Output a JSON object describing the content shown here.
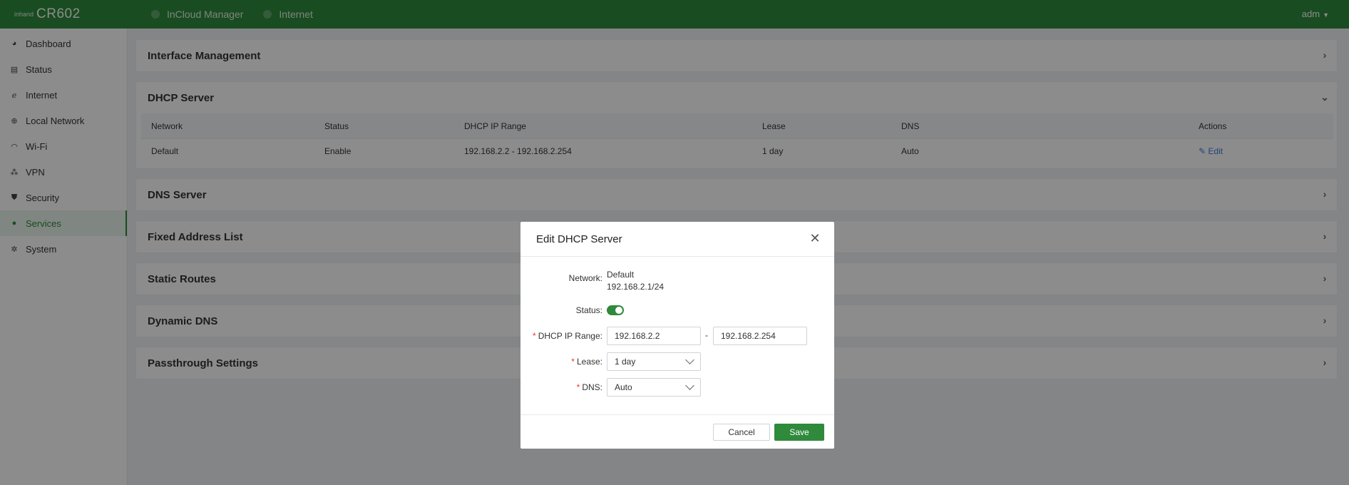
{
  "brand": {
    "logo_mark": "inhand",
    "product": "CR602"
  },
  "topnav": [
    {
      "label": "InCloud Manager"
    },
    {
      "label": "Internet"
    }
  ],
  "user": {
    "name": "adm"
  },
  "sidebar": {
    "items": [
      {
        "label": "Dashboard",
        "icon": "dashboard-icon"
      },
      {
        "label": "Status",
        "icon": "status-icon"
      },
      {
        "label": "Internet",
        "icon": "internet-icon"
      },
      {
        "label": "Local Network",
        "icon": "globe-icon"
      },
      {
        "label": "Wi-Fi",
        "icon": "wifi-icon"
      },
      {
        "label": "VPN",
        "icon": "vpn-icon"
      },
      {
        "label": "Security",
        "icon": "shield-icon"
      },
      {
        "label": "Services",
        "icon": "services-icon",
        "active": true
      },
      {
        "label": "System",
        "icon": "gear-icon"
      }
    ]
  },
  "panels": {
    "interface_management": "Interface Management",
    "dhcp_server": "DHCP Server",
    "dns_server": "DNS Server",
    "fixed_address_list": "Fixed Address List",
    "static_routes": "Static Routes",
    "dynamic_dns": "Dynamic DNS",
    "passthrough_settings": "Passthrough Settings"
  },
  "dhcp_table": {
    "columns": [
      "Network",
      "Status",
      "DHCP IP Range",
      "Lease",
      "DNS",
      "Actions"
    ],
    "rows": [
      {
        "network": "Default",
        "status": "Enable",
        "range": "192.168.2.2 - 192.168.2.254",
        "lease": "1 day",
        "dns": "Auto",
        "action": "Edit"
      }
    ]
  },
  "modal": {
    "title": "Edit DHCP Server",
    "network_label": "Network:",
    "network_name": "Default",
    "network_subnet": "192.168.2.1/24",
    "status_label": "Status:",
    "status_enabled": true,
    "range_label": "DHCP IP Range:",
    "range_start": "192.168.2.2",
    "range_separator": "-",
    "range_end": "192.168.2.254",
    "lease_label": "Lease:",
    "lease_value": "1 day",
    "dns_label": "DNS:",
    "dns_value": "Auto",
    "required_mark": "*",
    "cancel_label": "Cancel",
    "save_label": "Save"
  },
  "colors": {
    "brand_green": "#2f8a3c",
    "link_blue": "#3b7ddd",
    "required_red": "#ee3333"
  }
}
